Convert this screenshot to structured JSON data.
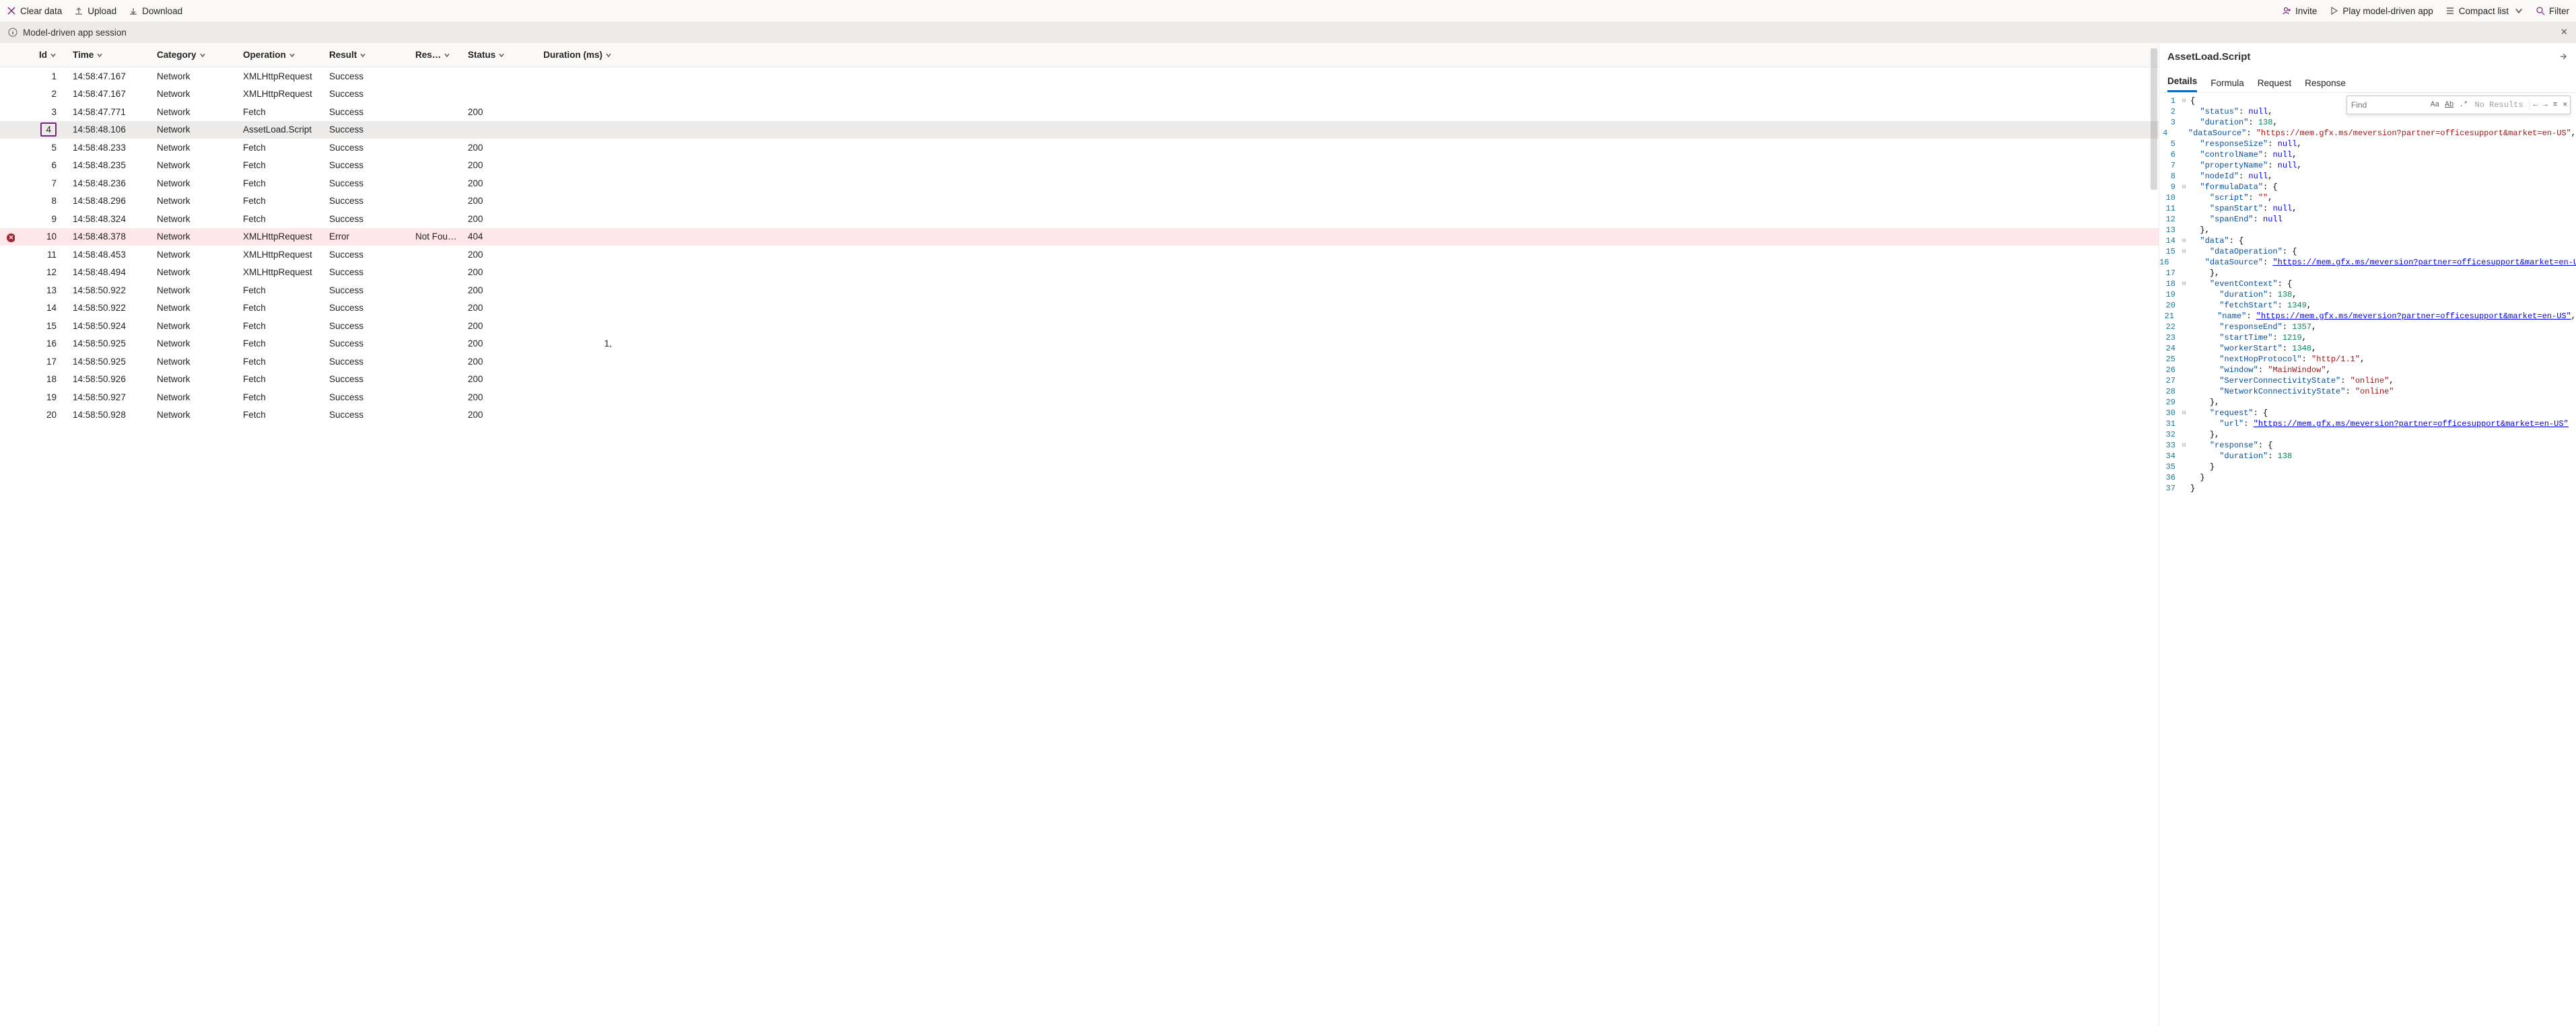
{
  "toolbar": {
    "clear": "Clear data",
    "upload": "Upload",
    "download": "Download",
    "invite": "Invite",
    "play": "Play model-driven app",
    "compact": "Compact list",
    "filter": "Filter"
  },
  "session": {
    "label": "Model-driven app session"
  },
  "grid": {
    "headers": {
      "id": "Id",
      "time": "Time",
      "category": "Category",
      "operation": "Operation",
      "result": "Result",
      "res2": "Res…",
      "status": "Status",
      "duration": "Duration (ms)"
    },
    "rows": [
      {
        "id": "1",
        "time": "14:58:47.167",
        "category": "Network",
        "operation": "XMLHttpRequest",
        "result": "Success",
        "res2": "",
        "status": "",
        "duration": "",
        "sel": false,
        "err": false
      },
      {
        "id": "2",
        "time": "14:58:47.167",
        "category": "Network",
        "operation": "XMLHttpRequest",
        "result": "Success",
        "res2": "",
        "status": "",
        "duration": "",
        "sel": false,
        "err": false
      },
      {
        "id": "3",
        "time": "14:58:47.771",
        "category": "Network",
        "operation": "Fetch",
        "result": "Success",
        "res2": "",
        "status": "200",
        "duration": "",
        "sel": false,
        "err": false
      },
      {
        "id": "4",
        "time": "14:58:48.106",
        "category": "Network",
        "operation": "AssetLoad.Script",
        "result": "Success",
        "res2": "",
        "status": "",
        "duration": "",
        "sel": true,
        "err": false
      },
      {
        "id": "5",
        "time": "14:58:48.233",
        "category": "Network",
        "operation": "Fetch",
        "result": "Success",
        "res2": "",
        "status": "200",
        "duration": "",
        "sel": false,
        "err": false
      },
      {
        "id": "6",
        "time": "14:58:48.235",
        "category": "Network",
        "operation": "Fetch",
        "result": "Success",
        "res2": "",
        "status": "200",
        "duration": "",
        "sel": false,
        "err": false
      },
      {
        "id": "7",
        "time": "14:58:48.236",
        "category": "Network",
        "operation": "Fetch",
        "result": "Success",
        "res2": "",
        "status": "200",
        "duration": "",
        "sel": false,
        "err": false
      },
      {
        "id": "8",
        "time": "14:58:48.296",
        "category": "Network",
        "operation": "Fetch",
        "result": "Success",
        "res2": "",
        "status": "200",
        "duration": "",
        "sel": false,
        "err": false
      },
      {
        "id": "9",
        "time": "14:58:48.324",
        "category": "Network",
        "operation": "Fetch",
        "result": "Success",
        "res2": "",
        "status": "200",
        "duration": "",
        "sel": false,
        "err": false
      },
      {
        "id": "10",
        "time": "14:58:48.378",
        "category": "Network",
        "operation": "XMLHttpRequest",
        "result": "Error",
        "res2": "Not Fou…",
        "status": "404",
        "duration": "",
        "sel": false,
        "err": true
      },
      {
        "id": "11",
        "time": "14:58:48.453",
        "category": "Network",
        "operation": "XMLHttpRequest",
        "result": "Success",
        "res2": "",
        "status": "200",
        "duration": "",
        "sel": false,
        "err": false
      },
      {
        "id": "12",
        "time": "14:58:48.494",
        "category": "Network",
        "operation": "XMLHttpRequest",
        "result": "Success",
        "res2": "",
        "status": "200",
        "duration": "",
        "sel": false,
        "err": false
      },
      {
        "id": "13",
        "time": "14:58:50.922",
        "category": "Network",
        "operation": "Fetch",
        "result": "Success",
        "res2": "",
        "status": "200",
        "duration": "",
        "sel": false,
        "err": false
      },
      {
        "id": "14",
        "time": "14:58:50.922",
        "category": "Network",
        "operation": "Fetch",
        "result": "Success",
        "res2": "",
        "status": "200",
        "duration": "",
        "sel": false,
        "err": false
      },
      {
        "id": "15",
        "time": "14:58:50.924",
        "category": "Network",
        "operation": "Fetch",
        "result": "Success",
        "res2": "",
        "status": "200",
        "duration": "",
        "sel": false,
        "err": false
      },
      {
        "id": "16",
        "time": "14:58:50.925",
        "category": "Network",
        "operation": "Fetch",
        "result": "Success",
        "res2": "",
        "status": "200",
        "duration": "1,",
        "sel": false,
        "err": false
      },
      {
        "id": "17",
        "time": "14:58:50.925",
        "category": "Network",
        "operation": "Fetch",
        "result": "Success",
        "res2": "",
        "status": "200",
        "duration": "",
        "sel": false,
        "err": false
      },
      {
        "id": "18",
        "time": "14:58:50.926",
        "category": "Network",
        "operation": "Fetch",
        "result": "Success",
        "res2": "",
        "status": "200",
        "duration": "",
        "sel": false,
        "err": false
      },
      {
        "id": "19",
        "time": "14:58:50.927",
        "category": "Network",
        "operation": "Fetch",
        "result": "Success",
        "res2": "",
        "status": "200",
        "duration": "",
        "sel": false,
        "err": false
      },
      {
        "id": "20",
        "time": "14:58:50.928",
        "category": "Network",
        "operation": "Fetch",
        "result": "Success",
        "res2": "",
        "status": "200",
        "duration": "",
        "sel": false,
        "err": false
      }
    ]
  },
  "details": {
    "title": "AssetLoad.Script",
    "tabs": {
      "details": "Details",
      "formula": "Formula",
      "request": "Request",
      "response": "Response"
    },
    "find": {
      "placeholder": "Find",
      "noresults": "No Results"
    },
    "code": [
      {
        "n": 1,
        "fold": "-",
        "ind": 0,
        "tokens": [
          [
            "punc",
            "{"
          ]
        ]
      },
      {
        "n": 2,
        "fold": "",
        "ind": 1,
        "tokens": [
          [
            "key",
            "\"status\""
          ],
          [
            "punc",
            ": "
          ],
          [
            "null",
            "null"
          ],
          [
            "punc",
            ","
          ]
        ]
      },
      {
        "n": 3,
        "fold": "",
        "ind": 1,
        "tokens": [
          [
            "key",
            "\"duration\""
          ],
          [
            "punc",
            ": "
          ],
          [
            "num",
            "138"
          ],
          [
            "punc",
            ","
          ]
        ]
      },
      {
        "n": 4,
        "fold": "",
        "ind": 1,
        "tokens": [
          [
            "key",
            "\"dataSource\""
          ],
          [
            "punc",
            ": "
          ],
          [
            "str",
            "\"https://mem.gfx.ms/meversion?partner=officesupport&market=en-US\""
          ],
          [
            "punc",
            ","
          ]
        ]
      },
      {
        "n": 5,
        "fold": "",
        "ind": 1,
        "tokens": [
          [
            "key",
            "\"responseSize\""
          ],
          [
            "punc",
            ": "
          ],
          [
            "null",
            "null"
          ],
          [
            "punc",
            ","
          ]
        ]
      },
      {
        "n": 6,
        "fold": "",
        "ind": 1,
        "tokens": [
          [
            "key",
            "\"controlName\""
          ],
          [
            "punc",
            ": "
          ],
          [
            "null",
            "null"
          ],
          [
            "punc",
            ","
          ]
        ]
      },
      {
        "n": 7,
        "fold": "",
        "ind": 1,
        "tokens": [
          [
            "key",
            "\"propertyName\""
          ],
          [
            "punc",
            ": "
          ],
          [
            "null",
            "null"
          ],
          [
            "punc",
            ","
          ]
        ]
      },
      {
        "n": 8,
        "fold": "",
        "ind": 1,
        "tokens": [
          [
            "key",
            "\"nodeId\""
          ],
          [
            "punc",
            ": "
          ],
          [
            "null",
            "null"
          ],
          [
            "punc",
            ","
          ]
        ]
      },
      {
        "n": 9,
        "fold": "-",
        "ind": 1,
        "tokens": [
          [
            "key",
            "\"formulaData\""
          ],
          [
            "punc",
            ": {"
          ]
        ]
      },
      {
        "n": 10,
        "fold": "",
        "ind": 2,
        "tokens": [
          [
            "key",
            "\"script\""
          ],
          [
            "punc",
            ": "
          ],
          [
            "str",
            "\"\""
          ],
          [
            "punc",
            ","
          ]
        ]
      },
      {
        "n": 11,
        "fold": "",
        "ind": 2,
        "tokens": [
          [
            "key",
            "\"spanStart\""
          ],
          [
            "punc",
            ": "
          ],
          [
            "null",
            "null"
          ],
          [
            "punc",
            ","
          ]
        ]
      },
      {
        "n": 12,
        "fold": "",
        "ind": 2,
        "tokens": [
          [
            "key",
            "\"spanEnd\""
          ],
          [
            "punc",
            ": "
          ],
          [
            "null",
            "null"
          ]
        ]
      },
      {
        "n": 13,
        "fold": "",
        "ind": 1,
        "tokens": [
          [
            "punc",
            "},"
          ]
        ]
      },
      {
        "n": 14,
        "fold": "-",
        "ind": 1,
        "tokens": [
          [
            "key",
            "\"data\""
          ],
          [
            "punc",
            ": {"
          ]
        ]
      },
      {
        "n": 15,
        "fold": "-",
        "ind": 2,
        "tokens": [
          [
            "key",
            "\"dataOperation\""
          ],
          [
            "punc",
            ": {"
          ]
        ]
      },
      {
        "n": 16,
        "fold": "",
        "ind": 3,
        "tokens": [
          [
            "key",
            "\"dataSource\""
          ],
          [
            "punc",
            ": "
          ],
          [
            "url",
            "\"https://mem.gfx.ms/meversion?partner=officesupport&market=en-US\""
          ]
        ]
      },
      {
        "n": 17,
        "fold": "",
        "ind": 2,
        "tokens": [
          [
            "punc",
            "},"
          ]
        ]
      },
      {
        "n": 18,
        "fold": "-",
        "ind": 2,
        "tokens": [
          [
            "key",
            "\"eventContext\""
          ],
          [
            "punc",
            ": {"
          ]
        ]
      },
      {
        "n": 19,
        "fold": "",
        "ind": 3,
        "tokens": [
          [
            "key",
            "\"duration\""
          ],
          [
            "punc",
            ": "
          ],
          [
            "num",
            "138"
          ],
          [
            "punc",
            ","
          ]
        ]
      },
      {
        "n": 20,
        "fold": "",
        "ind": 3,
        "tokens": [
          [
            "key",
            "\"fetchStart\""
          ],
          [
            "punc",
            ": "
          ],
          [
            "num",
            "1349"
          ],
          [
            "punc",
            ","
          ]
        ]
      },
      {
        "n": 21,
        "fold": "",
        "ind": 3,
        "tokens": [
          [
            "key",
            "\"name\""
          ],
          [
            "punc",
            ": "
          ],
          [
            "url",
            "\"https://mem.gfx.ms/meversion?partner=officesupport&market=en-US\""
          ],
          [
            "punc",
            ","
          ]
        ]
      },
      {
        "n": 22,
        "fold": "",
        "ind": 3,
        "tokens": [
          [
            "key",
            "\"responseEnd\""
          ],
          [
            "punc",
            ": "
          ],
          [
            "num",
            "1357"
          ],
          [
            "punc",
            ","
          ]
        ]
      },
      {
        "n": 23,
        "fold": "",
        "ind": 3,
        "tokens": [
          [
            "key",
            "\"startTime\""
          ],
          [
            "punc",
            ": "
          ],
          [
            "num",
            "1219"
          ],
          [
            "punc",
            ","
          ]
        ]
      },
      {
        "n": 24,
        "fold": "",
        "ind": 3,
        "tokens": [
          [
            "key",
            "\"workerStart\""
          ],
          [
            "punc",
            ": "
          ],
          [
            "num",
            "1348"
          ],
          [
            "punc",
            ","
          ]
        ]
      },
      {
        "n": 25,
        "fold": "",
        "ind": 3,
        "tokens": [
          [
            "key",
            "\"nextHopProtocol\""
          ],
          [
            "punc",
            ": "
          ],
          [
            "str",
            "\"http/1.1\""
          ],
          [
            "punc",
            ","
          ]
        ]
      },
      {
        "n": 26,
        "fold": "",
        "ind": 3,
        "tokens": [
          [
            "key",
            "\"window\""
          ],
          [
            "punc",
            ": "
          ],
          [
            "str",
            "\"MainWindow\""
          ],
          [
            "punc",
            ","
          ]
        ]
      },
      {
        "n": 27,
        "fold": "",
        "ind": 3,
        "tokens": [
          [
            "key",
            "\"ServerConnectivityState\""
          ],
          [
            "punc",
            ": "
          ],
          [
            "str",
            "\"online\""
          ],
          [
            "punc",
            ","
          ]
        ]
      },
      {
        "n": 28,
        "fold": "",
        "ind": 3,
        "tokens": [
          [
            "key",
            "\"NetworkConnectivityState\""
          ],
          [
            "punc",
            ": "
          ],
          [
            "str",
            "\"online\""
          ]
        ]
      },
      {
        "n": 29,
        "fold": "",
        "ind": 2,
        "tokens": [
          [
            "punc",
            "},"
          ]
        ]
      },
      {
        "n": 30,
        "fold": "-",
        "ind": 2,
        "tokens": [
          [
            "key",
            "\"request\""
          ],
          [
            "punc",
            ": {"
          ]
        ]
      },
      {
        "n": 31,
        "fold": "",
        "ind": 3,
        "tokens": [
          [
            "key",
            "\"url\""
          ],
          [
            "punc",
            ": "
          ],
          [
            "url",
            "\"https://mem.gfx.ms/meversion?partner=officesupport&market=en-US\""
          ]
        ]
      },
      {
        "n": 32,
        "fold": "",
        "ind": 2,
        "tokens": [
          [
            "punc",
            "},"
          ]
        ]
      },
      {
        "n": 33,
        "fold": "-",
        "ind": 2,
        "tokens": [
          [
            "key",
            "\"response\""
          ],
          [
            "punc",
            ": {"
          ]
        ]
      },
      {
        "n": 34,
        "fold": "",
        "ind": 3,
        "tokens": [
          [
            "key",
            "\"duration\""
          ],
          [
            "punc",
            ": "
          ],
          [
            "num",
            "138"
          ]
        ]
      },
      {
        "n": 35,
        "fold": "",
        "ind": 2,
        "tokens": [
          [
            "punc",
            "}"
          ]
        ]
      },
      {
        "n": 36,
        "fold": "",
        "ind": 1,
        "tokens": [
          [
            "punc",
            "}"
          ]
        ]
      },
      {
        "n": 37,
        "fold": "",
        "ind": 0,
        "tokens": [
          [
            "punc",
            "}"
          ]
        ]
      }
    ]
  }
}
